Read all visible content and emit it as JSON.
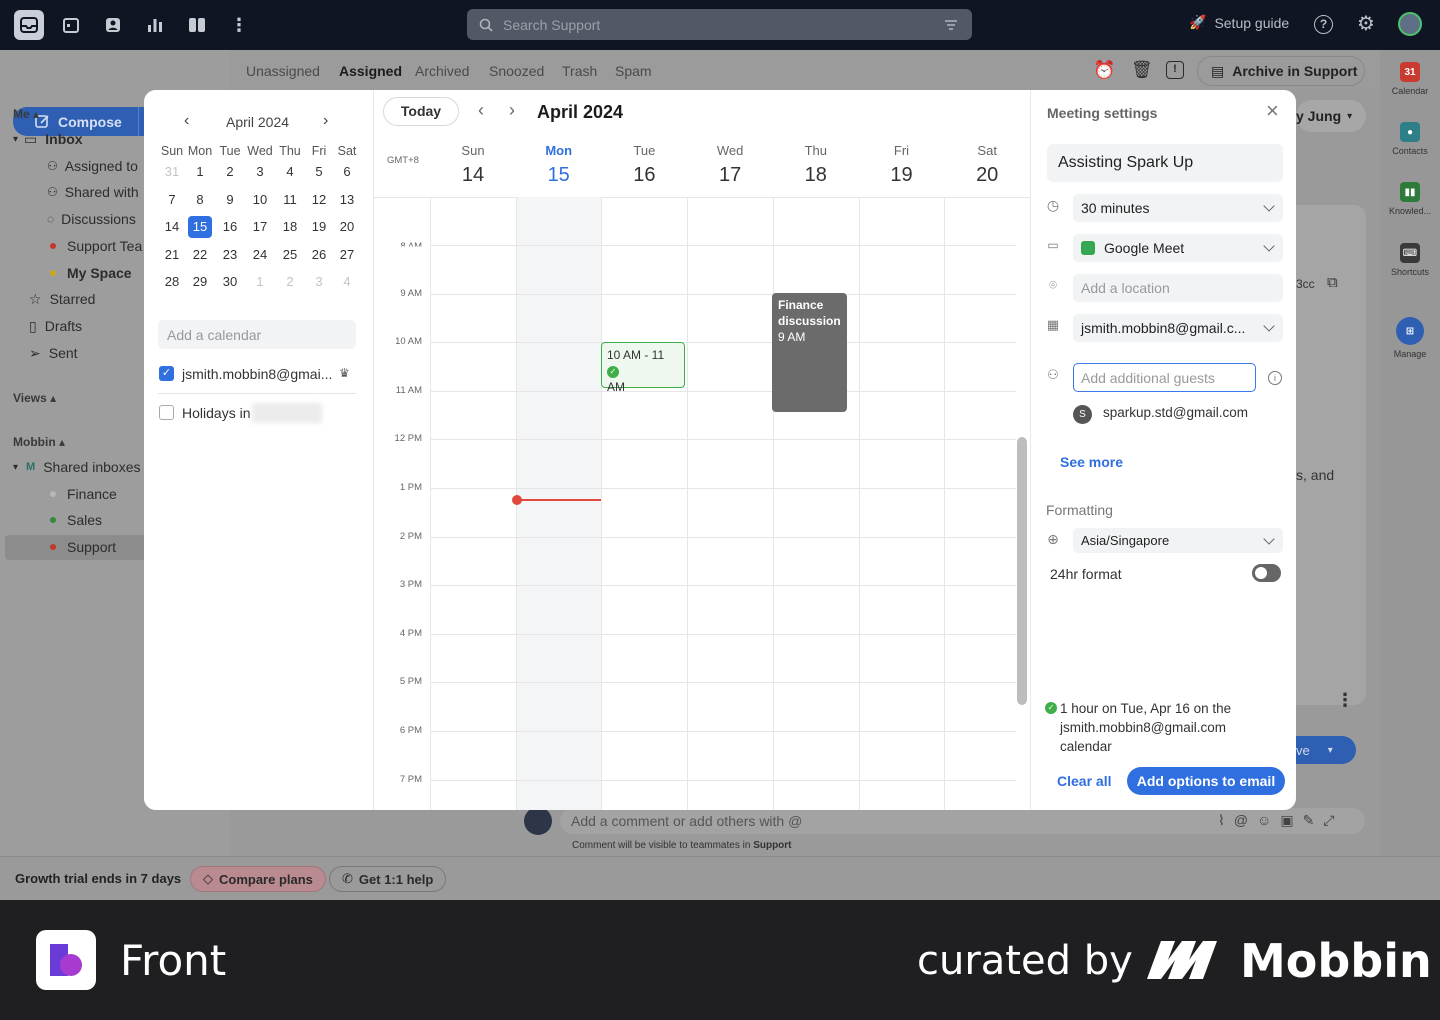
{
  "topbar": {
    "search_placeholder": "Search Support",
    "setup_guide": "Setup guide"
  },
  "sidebar": {
    "compose": "Compose",
    "me_section": "Me",
    "inbox": "Inbox",
    "items": [
      "Assigned to",
      "Shared with",
      "Discussions",
      "Support Tea",
      "My Space"
    ],
    "starred": "Starred",
    "drafts": "Drafts",
    "sent": "Sent",
    "views_section": "Views",
    "mobbin_section": "Mobbin",
    "shared_inboxes": "Shared inboxes",
    "shared_inbox_badge": "M",
    "inboxes": [
      "Finance",
      "Sales",
      "Support"
    ]
  },
  "main": {
    "tabs": [
      "Unassigned",
      "Assigned",
      "Archived",
      "Snoozed",
      "Trash",
      "Spam"
    ],
    "archive_button": "Archive in Support",
    "behind_name": "y Jung",
    "behind_bcc": "3cc",
    "behind_text": "s, and",
    "behind_send": "ve",
    "comment_placeholder": "Add a comment or add others with @",
    "comment_hint_prefix": "Comment will be visible to teammates in ",
    "comment_hint_inbox": "Support"
  },
  "rail": [
    {
      "label": "Calendar",
      "glyph": "31"
    },
    {
      "label": "Contacts",
      "glyph": ""
    },
    {
      "label": "Knowled...",
      "glyph": ""
    },
    {
      "label": "Shortcuts",
      "glyph": ""
    },
    {
      "label": "Manage",
      "glyph": ""
    }
  ],
  "bottom": {
    "trial": "Growth trial ends in 7 days",
    "compare": "Compare plans",
    "help": "Get 1:1 help"
  },
  "mini_calendar": {
    "month": "April 2024",
    "weekdays": [
      "Sun",
      "Mon",
      "Tue",
      "Wed",
      "Thu",
      "Fri",
      "Sat"
    ],
    "weeks": [
      [
        "31",
        "1",
        "2",
        "3",
        "4",
        "5",
        "6"
      ],
      [
        "7",
        "8",
        "9",
        "10",
        "11",
        "12",
        "13"
      ],
      [
        "14",
        "15",
        "16",
        "17",
        "18",
        "19",
        "20"
      ],
      [
        "21",
        "22",
        "23",
        "24",
        "25",
        "26",
        "27"
      ],
      [
        "28",
        "29",
        "30",
        "1",
        "2",
        "3",
        "4"
      ]
    ],
    "add_calendar_placeholder": "Add a calendar",
    "calendars": [
      {
        "label": "jsmith.mobbin8@gmai...",
        "checked": true
      },
      {
        "label": "Holidays in",
        "checked": false
      }
    ]
  },
  "week_view": {
    "today_button": "Today",
    "title": "April 2024",
    "timezone": "GMT+8",
    "days": [
      {
        "name": "Sun",
        "date": "14"
      },
      {
        "name": "Mon",
        "date": "15"
      },
      {
        "name": "Tue",
        "date": "16"
      },
      {
        "name": "Wed",
        "date": "17"
      },
      {
        "name": "Thu",
        "date": "18"
      },
      {
        "name": "Fri",
        "date": "19"
      },
      {
        "name": "Sat",
        "date": "20"
      }
    ],
    "hours": [
      "8 AM",
      "9 AM",
      "10 AM",
      "11 AM",
      "12 PM",
      "1 PM",
      "2 PM",
      "3 PM",
      "4 PM",
      "5 PM",
      "6 PM",
      "7 PM"
    ],
    "events": [
      {
        "title": "10 AM - 11",
        "title2": "AM"
      },
      {
        "title": "Finance",
        "title2": "discussion",
        "time": "9 AM"
      }
    ]
  },
  "meeting_settings": {
    "header": "Meeting settings",
    "title_value": "Assisting Spark Up",
    "duration": "30 minutes",
    "conference": "Google Meet",
    "location_placeholder": "Add a location",
    "calendar": "jsmith.mobbin8@gmail.c...",
    "guests_placeholder": "Add additional guests",
    "guest": {
      "initial": "S",
      "email": "sparkup.std@gmail.com"
    },
    "see_more": "See more",
    "formatting": "Formatting",
    "timezone": "Asia/Singapore",
    "hour_format": "24hr format",
    "summary_line1": "1 hour on Tue, Apr 16 on the",
    "summary_line2": "jsmith.mobbin8@gmail.com",
    "summary_line3": "calendar",
    "clear_all": "Clear all",
    "add_options": "Add options to email"
  },
  "branding": {
    "app": "Front",
    "curated": "curated by",
    "mobbin": "Mobbin"
  },
  "colors": {
    "accent": "#2f6fe0",
    "topbar": "#0f1523",
    "event_green": "#3fae4a",
    "event_gray": "#6b6b6b",
    "now_line": "#e0473d"
  }
}
